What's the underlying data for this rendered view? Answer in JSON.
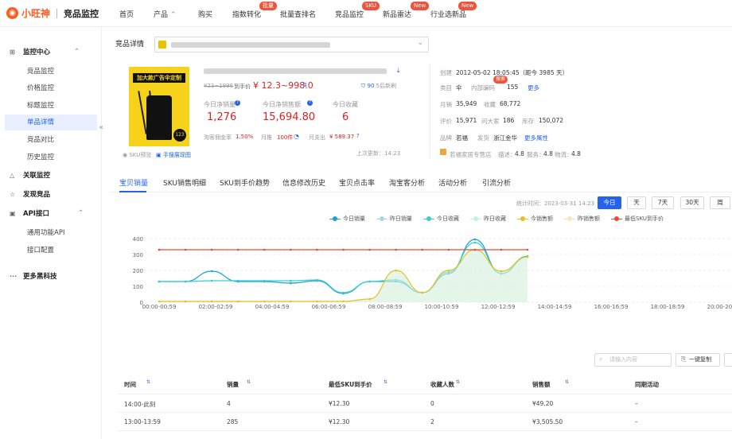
{
  "brand": {
    "logo_mark": "◉",
    "logo_text": "小旺神",
    "product": "竞品监控"
  },
  "nav": [
    {
      "label": "首页",
      "badge": ""
    },
    {
      "label": "产品",
      "badge": ""
    },
    {
      "label": "购买",
      "badge": ""
    },
    {
      "label": "指数转化",
      "badge": "批量"
    },
    {
      "label": "批量查排名",
      "badge": ""
    },
    {
      "label": "竞品监控",
      "badge": "SKU"
    },
    {
      "label": "新品雷达",
      "badge": "New"
    },
    {
      "label": "行业选新品",
      "badge": "New"
    }
  ],
  "sidebar": {
    "group1": "监控中心",
    "items": [
      "竞品监控",
      "价格监控",
      "标题监控",
      "单品详情",
      "竞品对比",
      "历史监控"
    ],
    "group2": "关联监控",
    "group3": "发现竞品",
    "group4": "API接口",
    "api_items": [
      "通用功能API",
      "接口配置"
    ],
    "group5": "更多黑科技"
  },
  "page": {
    "breadcrumb": "竞品详情"
  },
  "product": {
    "banner_text": "加大款广告伞定制",
    "sticker": "123",
    "price_original": "¥23~1996",
    "price_label": "到手价",
    "price": "¥ 12.3~998.0",
    "sales_after": "90",
    "sales_after_label": "5后新刷",
    "metric_labels": [
      "今日净销量",
      "今日净销售额",
      "今日收藏"
    ],
    "metric_values": [
      "1,276",
      "15,694.80",
      "6"
    ],
    "cost_label": "淘客佣金率",
    "cost_value": "1.50%",
    "month_label": "月推",
    "month_value": "100件",
    "expense_label": "月支出",
    "expense_value": "¥ 589.37",
    "sku_label": "SKU预览",
    "manual_label": "手搜展现图",
    "updated": "上次更新：14:23"
  },
  "info": {
    "created_label": "创建",
    "created_value": "2012-05-02 18:05:45（距今 3985 天）",
    "cat_label": "类目",
    "cat_value": "伞",
    "code_label": "内部编码",
    "code_value": "155",
    "more": "更多",
    "badge": "搜索",
    "month_sales_label": "月销",
    "month_sales": "35,949",
    "fav_label": "收藏",
    "fav": "68,772",
    "review_label": "评价",
    "review": "15,971",
    "ask_label": "问大家",
    "ask": "186",
    "stock_label": "库存",
    "stock": "150,072",
    "brand_label": "品牌",
    "brand": "若福",
    "ship_label": "发货",
    "ship": "浙江金华",
    "more_attr": "更多属性",
    "shop": "若福家居专营店",
    "desc_label": "描述：",
    "desc": "4.8",
    "service_label": "服务：",
    "service": "4.8",
    "logistics_label": "物流：",
    "logistics": "4.8"
  },
  "tabs": [
    "宝贝销量",
    "SKU销售明细",
    "SKU到手价趋势",
    "信息修改历史",
    "宝贝点击率",
    "淘宝客分析",
    "活动分析",
    "引流分析"
  ],
  "stats": {
    "time_label": "统计时间：",
    "time_value": "2023-03-31 14:23"
  },
  "ranges": [
    "今日",
    "天",
    "7天",
    "30天",
    "周"
  ],
  "legend": [
    {
      "name": "今日销量",
      "color": "#1aa3d4"
    },
    {
      "name": "昨日销量",
      "color": "#a7d6e9"
    },
    {
      "name": "今日收藏",
      "color": "#35d0cc"
    },
    {
      "name": "昨日收藏",
      "color": "#c5ece6"
    },
    {
      "name": "今销售额",
      "color": "#e7c021"
    },
    {
      "name": "昨销售额",
      "color": "#f1e7b7"
    },
    {
      "name": "最低SKU到手价",
      "color": "#e9483f"
    }
  ],
  "chart_data": {
    "type": "line",
    "x": [
      "00:00-00:59",
      "02:00-02:59",
      "04:00-04:59",
      "06:00-06:59",
      "08:00-08:59",
      "10:00-10:59",
      "12:00-12:59",
      "14:00-14:59",
      "16:00-16:59",
      "18:00-18:59",
      "20:00-20:59"
    ],
    "yticks": [
      0,
      100,
      200,
      300,
      400
    ],
    "ylim": [
      0,
      400
    ],
    "series": [
      {
        "name": "今日销量",
        "values": [
          130,
          130,
          195,
          130,
          130,
          120,
          135,
          55,
          130,
          130,
          60,
          180,
          395,
          180,
          285
        ]
      },
      {
        "name": "今日收藏",
        "values": [
          130,
          130,
          135,
          135,
          135,
          135,
          140,
          60,
          130,
          140,
          60,
          190,
          375,
          180,
          290
        ]
      },
      {
        "name": "今销售额",
        "values": [
          5,
          5,
          5,
          5,
          5,
          5,
          5,
          5,
          20,
          200,
          60,
          200,
          330,
          195,
          285
        ]
      },
      {
        "name": "最低SKU到手价",
        "values": [
          330,
          330,
          330,
          330,
          330,
          330,
          330,
          330,
          330,
          330,
          330,
          330,
          330,
          330,
          330
        ]
      }
    ]
  },
  "table": {
    "search_placeholder": "请输入内容",
    "copy_label": "一键复制",
    "headers": [
      "时间",
      "销量",
      "最低SKU到手价",
      "收藏人数",
      "销售额",
      "同期活动"
    ],
    "rows": [
      [
        "14:00-此刻",
        "4",
        "¥12.30",
        "0",
        "¥49.20",
        "–"
      ],
      [
        "13:00-13:59",
        "285",
        "¥12.30",
        "2",
        "¥3,505.50",
        "–"
      ]
    ]
  }
}
